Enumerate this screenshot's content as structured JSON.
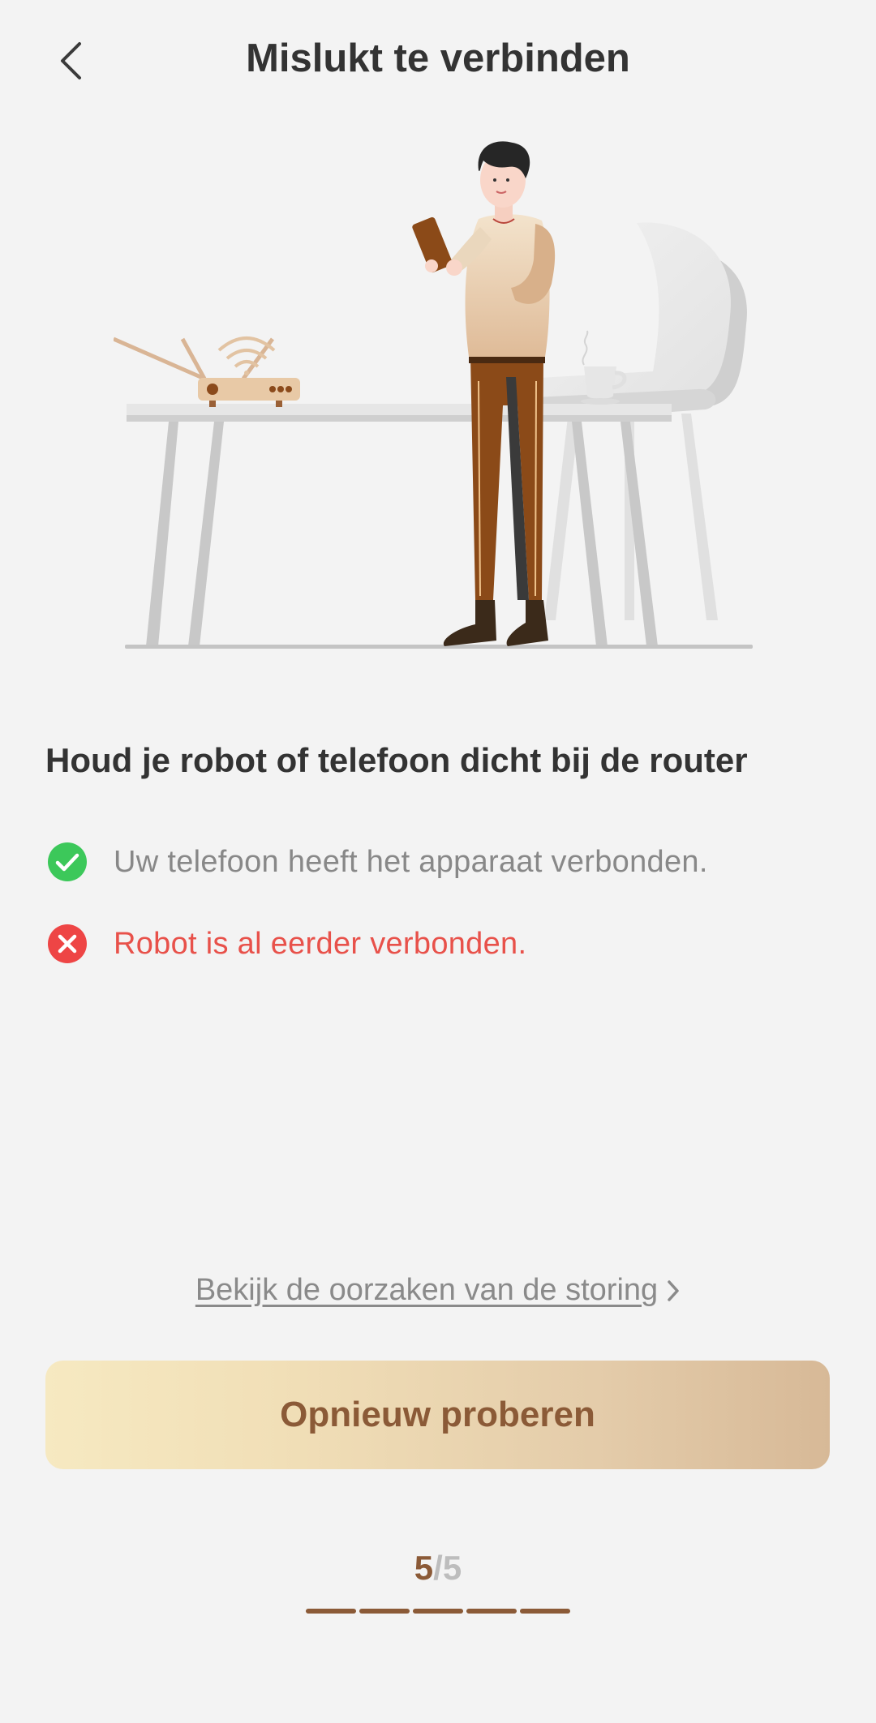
{
  "header": {
    "title": "Mislukt te verbinden",
    "back_icon": "chevron-left-icon"
  },
  "main": {
    "heading": "Houd je robot of telefoon dicht bij de router",
    "checks": [
      {
        "status": "success",
        "icon": "check-circle-icon",
        "color": "#3cc85a",
        "text": "Uw telefoon heeft het apparaat verbonden."
      },
      {
        "status": "error",
        "icon": "error-circle-icon",
        "color": "#ee4545",
        "text": "Robot is al eerder verbonden."
      }
    ],
    "cause_link": "Bekijk de oorzaken van de storing",
    "retry_button": "Opnieuw proberen"
  },
  "progress": {
    "current": "5",
    "separator": "/",
    "total": "5",
    "completed_fraction": 1.0
  },
  "colors": {
    "accent": "#8b5a37",
    "error": "#e8514a",
    "success": "#3cc85a",
    "background": "#f3f3f3"
  }
}
